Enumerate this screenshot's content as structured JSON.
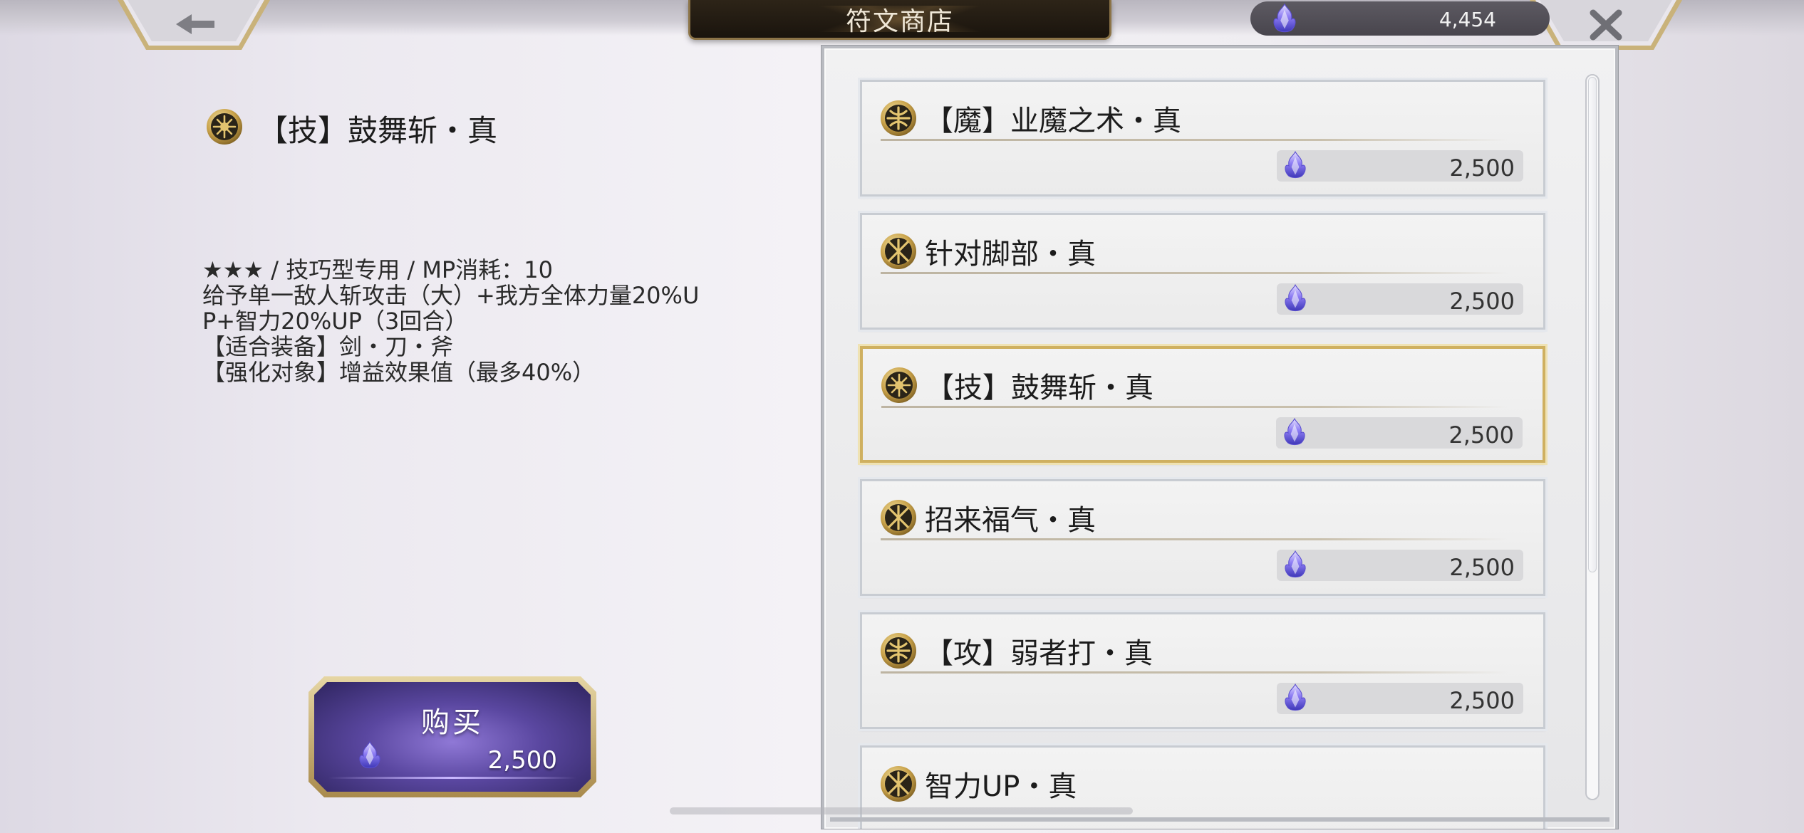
{
  "header": {
    "title": "符文商店",
    "currency_amount": "4,454",
    "back_icon": "arrow-left-icon",
    "close_icon": "close-x-icon"
  },
  "detail": {
    "icon": "rune-technique-icon",
    "title": "【技】鼓舞斩・真",
    "description_lines": [
      "★★★ / 技巧型专用 / MP消耗：10",
      "给予单一敌人斩攻击（大）+我方全体力量20%U",
      "P+智力20%UP（3回合）",
      "【适合装备】剑・刀・斧",
      "【强化对象】增益效果值（最多40%）"
    ]
  },
  "buy_button": {
    "label": "购买",
    "price": "2,500"
  },
  "rune_list": {
    "items": [
      {
        "name": "【魔】业魔之术・真",
        "price": "2,500",
        "icon": "rune-cross-icon",
        "selected": false
      },
      {
        "name": "针对脚部・真",
        "price": "2,500",
        "icon": "rune-star-icon",
        "selected": false
      },
      {
        "name": "【技】鼓舞斩・真",
        "price": "2,500",
        "icon": "rune-technique-icon",
        "selected": true
      },
      {
        "name": "招来福气・真",
        "price": "2,500",
        "icon": "rune-star-icon",
        "selected": false
      },
      {
        "name": "【攻】弱者打・真",
        "price": "2,500",
        "icon": "rune-cross-icon",
        "selected": false
      },
      {
        "name": "智力UP・真",
        "price": "",
        "icon": "rune-star-icon",
        "selected": false
      }
    ]
  },
  "colors": {
    "gold_frame": "#cfb060",
    "crystal": "#7b6cf0",
    "title_plate": "#1a140d"
  }
}
